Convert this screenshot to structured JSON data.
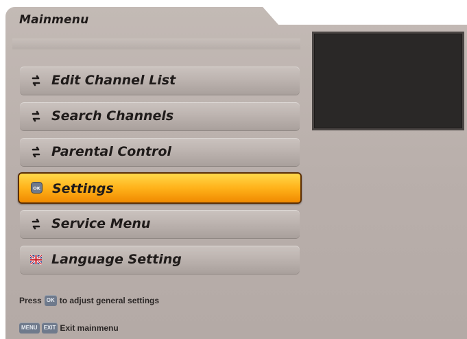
{
  "window": {
    "title": "Mainmenu"
  },
  "menu": {
    "items": [
      {
        "label": "Edit Channel List",
        "icon": "arrow-swap-icon",
        "active": false
      },
      {
        "label": "Search Channels",
        "icon": "arrow-swap-icon",
        "active": false
      },
      {
        "label": "Parental Control",
        "icon": "arrow-swap-icon",
        "active": false
      },
      {
        "label": "Settings",
        "icon": "ok-icon",
        "active": true
      },
      {
        "label": "Service Menu",
        "icon": "arrow-swap-icon",
        "active": false
      },
      {
        "label": "Language Setting",
        "icon": "uk-flag-icon",
        "active": false
      }
    ]
  },
  "hint": {
    "prefix": "Press",
    "key": "OK",
    "suffix": "to adjust general settings"
  },
  "footer": {
    "key1": "MENU",
    "key2": "EXIT",
    "label": "Exit mainmenu"
  },
  "colors": {
    "accent": "#ffb21a",
    "panel": "#bdb4b0",
    "text": "#1f1b1a"
  }
}
